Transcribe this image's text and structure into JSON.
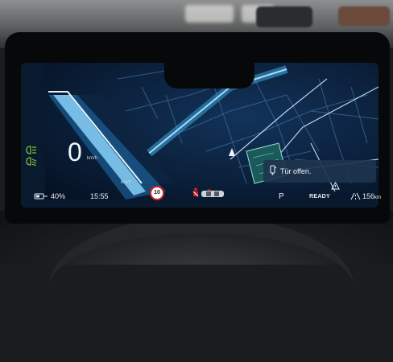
{
  "cluster": {
    "speed": "0",
    "speed_unit": "km/h",
    "map_scale_unit": "km/h"
  },
  "status": {
    "battery_percent": "40%",
    "time": "15:55",
    "gear": "P",
    "ready_label": "READY",
    "range_value": "156",
    "range_unit": "km",
    "speed_limit": "10"
  },
  "notification": {
    "text": "Tür offen."
  },
  "icons": [
    "headlight-icon",
    "low-beam-icon",
    "battery-plug-icon",
    "seatbelt-warning-icon",
    "car-door-icon",
    "door-open-notification-icon",
    "warning-triangle-icon",
    "range-road-icon",
    "navigation-arrow-icon"
  ],
  "colors": {
    "accent": "#3ab7e8",
    "map_background": "#0a1a2e",
    "indicator_green": "#7ec63a",
    "warning_red": "#d81e1e"
  }
}
